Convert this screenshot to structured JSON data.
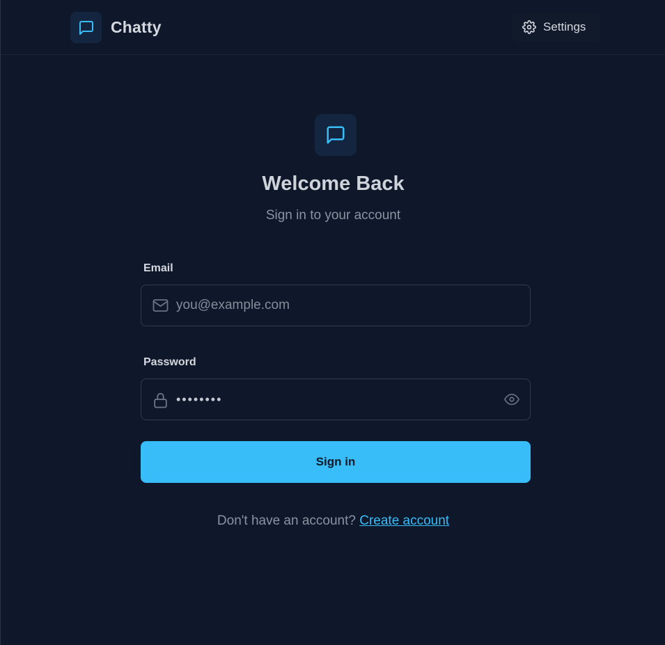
{
  "app": {
    "name": "Chatty"
  },
  "header": {
    "settings_label": "Settings"
  },
  "auth": {
    "title": "Welcome Back",
    "subtitle": "Sign in to your account",
    "email": {
      "label": "Email",
      "placeholder": "you@example.com",
      "value": ""
    },
    "password": {
      "label": "Password",
      "value": "••••••••"
    },
    "submit_label": "Sign in",
    "signup_prompt": "Don't have an account?",
    "signup_link": "Create account"
  },
  "colors": {
    "background": "#0f172a",
    "accent": "#38bdf8",
    "logo_tile": "#14263f"
  },
  "icons": {
    "brand": "chat-bubble-icon",
    "settings": "gear-icon",
    "email": "mail-icon",
    "password": "lock-icon",
    "toggle_visibility": "eye-icon"
  }
}
